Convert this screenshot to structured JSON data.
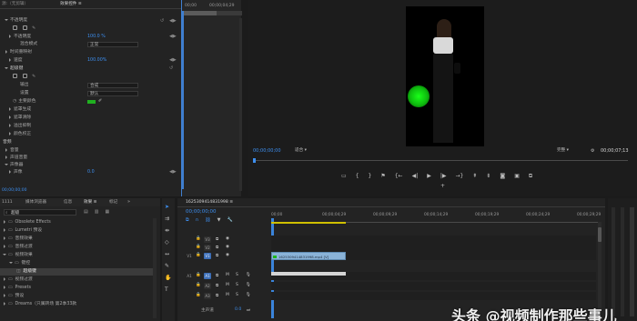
{
  "effect_controls": {
    "tab1": "源:（无剪辑）",
    "tab2": "效果控件 ≡",
    "clip_name": "1625309414831998.mp4",
    "clip_ref": "1625309414831998 * 1625309414831998.mp4",
    "opacity_label": "不透明度",
    "opacity_value": "100.0 %",
    "blend_label": "混合模式",
    "blend_value": "正常",
    "time_remap": "时间重映射",
    "speed_label": "速度",
    "speed_value": "100.00%",
    "ultra_key": "超级键",
    "output_label": "输出",
    "output_value": "合成",
    "setting_label": "设置",
    "setting_value": "默认",
    "key_color_label": "主要颜色",
    "key_color": "#20b020",
    "mask_gen": "遮罩生成",
    "mask_clean": "遮罩清除",
    "spill": "溢出抑制",
    "color_correct": "颜色校正",
    "audio_section": "音频",
    "volume": "音量",
    "channel_volume": "声道音量",
    "panner": "声像器",
    "pan_label": "声像",
    "pan_value": "0.0",
    "timecode": "00;00;00;00",
    "ruler_start": "00;00",
    "ruler_mark": "00;00;04;29"
  },
  "program": {
    "timecode": "00;00;00;00",
    "fit": "适合",
    "quality": "完整",
    "duration": "00;00;07;13"
  },
  "project": {
    "tabs": [
      "1111",
      "媒体浏览器",
      "信息",
      "效果 ≡",
      "标记"
    ],
    "search_value": "超级",
    "items": [
      {
        "label": "Obsolete Effects",
        "indent": 0
      },
      {
        "label": "Lumetri 预设",
        "indent": 0
      },
      {
        "label": "音频效果",
        "indent": 0
      },
      {
        "label": "音频过渡",
        "indent": 0
      },
      {
        "label": "视频效果",
        "indent": 0
      },
      {
        "label": "键控",
        "indent": 1
      },
      {
        "label": "超级键",
        "indent": 2,
        "selected": true
      },
      {
        "label": "视频过渡",
        "indent": 0
      },
      {
        "label": "Presets",
        "indent": 0
      },
      {
        "label": "预设",
        "indent": 0
      },
      {
        "label": "Dreams（只属转场 第2季33款",
        "indent": 0
      }
    ]
  },
  "timeline": {
    "tab": "1625309414831998 ≡",
    "timecode": "00;00;00;00",
    "ruler_labels": [
      "00;00",
      "00;00;04;29",
      "00;00;09;29",
      "00;00;14;29",
      "00;00;19;29",
      "00;00;24;29",
      "00;00;29;29"
    ],
    "video_tracks": [
      "V3",
      "V2",
      "V1"
    ],
    "audio_tracks": [
      "A1",
      "A2",
      "A3"
    ],
    "v1_side": "V1",
    "a1_side": "A1",
    "clip_label": "1625309414831998.mp4 [V]",
    "master_label": "主声道",
    "master_value": "0.0"
  },
  "watermark": "头条 @视频制作那些事儿"
}
